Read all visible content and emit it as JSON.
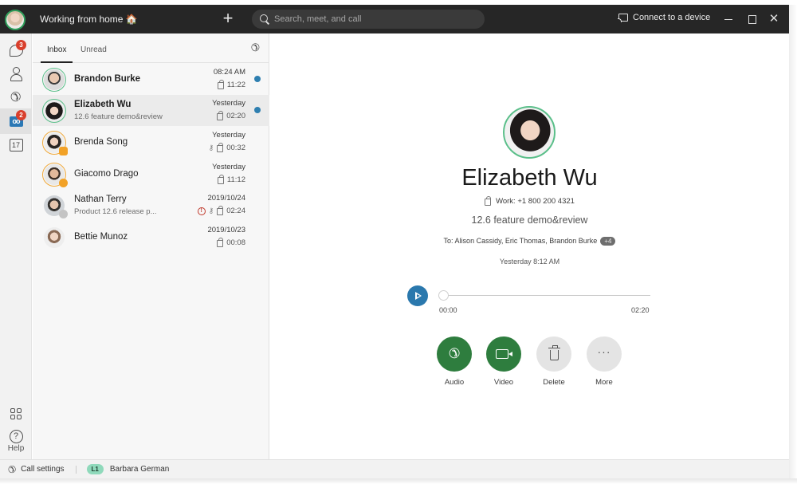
{
  "titlebar": {
    "status": "Working from home 🏠",
    "search_placeholder": "Search, meet, and call",
    "connect_label": "Connect to a device",
    "close_glyph": "✕"
  },
  "rail": {
    "messages_badge": "3",
    "voicemail_badge": "2",
    "voicemail_glyph": "oo",
    "calendar_day": "17",
    "help_glyph": "?",
    "help_label": "Help",
    "phone_glyph": "✆"
  },
  "list": {
    "tabs": [
      {
        "label": "Inbox",
        "active": true
      },
      {
        "label": "Unread",
        "active": false
      }
    ],
    "call_history_glyph": "✆",
    "items": [
      {
        "name": "Brandon Burke",
        "preview": "",
        "date": "08:24 AM",
        "duration": "11:22",
        "bold": true,
        "unread": true,
        "selected": false,
        "key": false,
        "alert": false
      },
      {
        "name": "Elizabeth Wu",
        "preview": "12.6 feature demo&review",
        "date": "Yesterday",
        "duration": "02:20",
        "bold": true,
        "unread": true,
        "selected": true,
        "key": false,
        "alert": false
      },
      {
        "name": "Brenda Song",
        "preview": "",
        "date": "Yesterday",
        "duration": "00:32",
        "bold": false,
        "unread": false,
        "selected": false,
        "key": true,
        "alert": false
      },
      {
        "name": "Giacomo Drago",
        "preview": "",
        "date": "Yesterday",
        "duration": "11:12",
        "bold": false,
        "unread": false,
        "selected": false,
        "key": false,
        "alert": false
      },
      {
        "name": "Nathan Terry",
        "preview": "Product 12.6 release p...",
        "date": "2019/10/24",
        "duration": "02:24",
        "bold": false,
        "unread": false,
        "selected": false,
        "key": true,
        "alert": true
      },
      {
        "name": "Bettie Munoz",
        "preview": "",
        "date": "2019/10/23",
        "duration": "00:08",
        "bold": false,
        "unread": false,
        "selected": false,
        "key": false,
        "alert": false
      }
    ],
    "key_glyph": "⚷",
    "alert_glyph": "!"
  },
  "detail": {
    "name": "Elizabeth Wu",
    "phone": "Work: +1 800 200 4321",
    "subject": "12.6 feature demo&review",
    "to": "To: Alison Cassidy, Eric Thomas, Brandon Burke",
    "more_recipients": "+4",
    "time": "Yesterday 8:12 AM",
    "playback": {
      "position": "00:00",
      "duration": "02:20",
      "progress": 0
    },
    "actions": [
      {
        "label": "Audio"
      },
      {
        "label": "Video"
      },
      {
        "label": "Delete"
      },
      {
        "label": "More"
      }
    ],
    "phone_glyph": "✆",
    "more_glyph": "···"
  },
  "bottombar": {
    "call_settings_label": "Call settings",
    "line_badge": "L1",
    "line_name": "Barbara German",
    "call_settings_glyph": "✆"
  },
  "colors": {
    "accent_blue": "#2a78ad",
    "call_green": "#2e7d3e",
    "badge_red": "#d93f2c",
    "presence_green": "#5bbf8a",
    "presence_orange": "#f0a93a"
  }
}
